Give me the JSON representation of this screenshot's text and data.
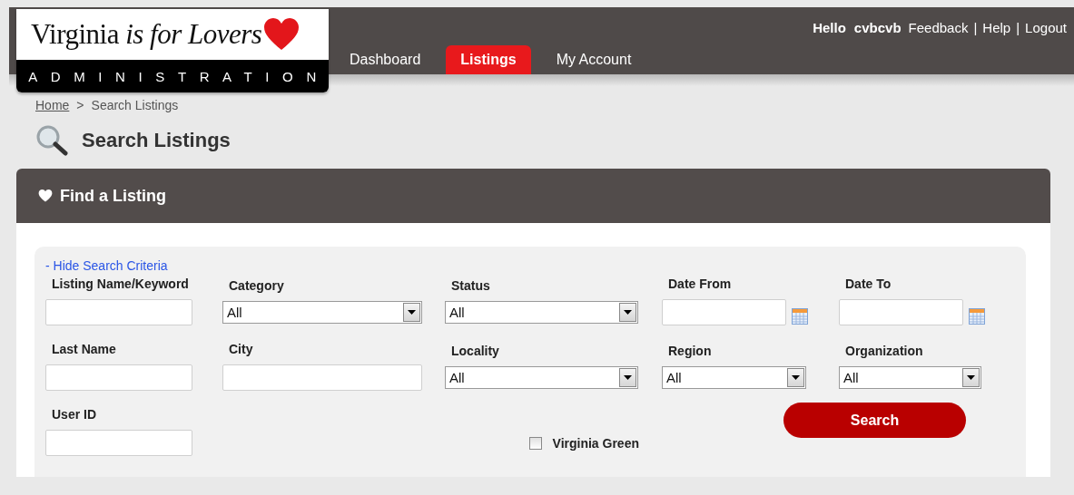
{
  "logo": {
    "wordmark": "Virginia *is for Lovers*",
    "subtitle": "ADMINISTRATION"
  },
  "nav": [
    {
      "label": "Dashboard",
      "selected": false
    },
    {
      "label": "Listings",
      "selected": true
    },
    {
      "label": "My Account",
      "selected": false
    }
  ],
  "user_bar": [
    {
      "kind": "greeting",
      "text": "Hello"
    },
    {
      "kind": "username",
      "text": "cvbcvb"
    },
    {
      "kind": "link",
      "text": "Feedback"
    },
    {
      "kind": "separator",
      "text": "|"
    },
    {
      "kind": "link",
      "text": "Help"
    },
    {
      "kind": "separator",
      "text": "|"
    },
    {
      "kind": "link",
      "text": "Logout"
    }
  ],
  "breadcrumb": [
    {
      "kind": "link",
      "text": "Home"
    },
    {
      "kind": "separator",
      "text": ">"
    },
    {
      "kind": "current",
      "text": "Search Listings"
    }
  ],
  "page_title": "Search Listings",
  "panel": {
    "title": "Find a Listing",
    "toggle_link": "- Hide Search Criteria",
    "rows": [
      {
        "fields": [
          {
            "kind": "text",
            "label": "Listing Name/Keyword"
          },
          {
            "kind": "select",
            "label": "Category",
            "value": "All"
          },
          {
            "kind": "select",
            "label": "Status",
            "value": "All"
          },
          {
            "kind": "date",
            "label": "Date From"
          },
          {
            "kind": "date",
            "label": "Date To"
          }
        ]
      },
      {
        "fields": [
          {
            "kind": "text",
            "label": "Last Name"
          },
          {
            "kind": "text",
            "label": "City"
          },
          {
            "kind": "select",
            "label": "Locality",
            "value": "All"
          },
          {
            "kind": "select",
            "label": "Region",
            "value": "All"
          },
          {
            "kind": "select",
            "label": "Organization",
            "value": "All"
          }
        ]
      },
      {
        "fields": [
          {
            "kind": "text",
            "label": "User ID"
          },
          {
            "kind": "checkbox",
            "label": "Virginia Green",
            "checked": false
          },
          {
            "kind": "button",
            "label": "Search"
          }
        ]
      }
    ]
  }
}
